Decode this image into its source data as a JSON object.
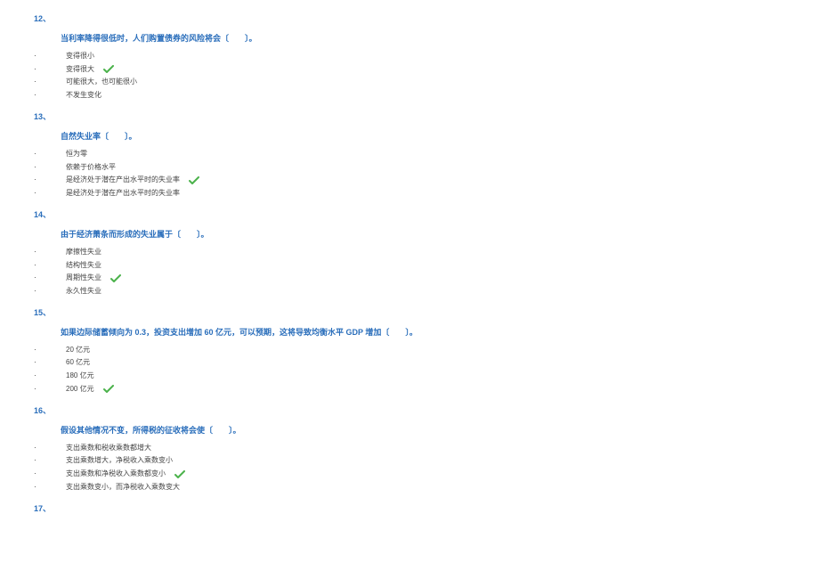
{
  "questions": [
    {
      "num": "12、",
      "stem": "当利率降得很低时，人们购置债券的风险将会〔　　〕。",
      "options": [
        {
          "text": "变得很小",
          "correct": false
        },
        {
          "text": "变得很大",
          "correct": true
        },
        {
          "text": "可能很大，也可能很小",
          "correct": false
        },
        {
          "text": "不发生变化",
          "correct": false
        }
      ]
    },
    {
      "num": "13、",
      "stem": "自然失业率〔　　〕。",
      "options": [
        {
          "text": "恒为零",
          "correct": false
        },
        {
          "text": "依赖于价格水平",
          "correct": false
        },
        {
          "text": "是经济处于潜在产出水平时的失业率",
          "correct": true
        },
        {
          "text": "是经济处于潜在产出水平时的失业率",
          "correct": false
        }
      ]
    },
    {
      "num": "14、",
      "stem": "由于经济萧条而形成的失业属于〔　　〕。",
      "options": [
        {
          "text": "摩擦性失业",
          "correct": false
        },
        {
          "text": "结构性失业",
          "correct": false
        },
        {
          "text": "周期性失业",
          "correct": true
        },
        {
          "text": "永久性失业",
          "correct": false
        }
      ]
    },
    {
      "num": "15、",
      "stem": "如果边际储蓄倾向为 0.3，投资支出增加 60 亿元，可以预期，这将导致均衡水平 GDP 增加〔　　〕。",
      "options": [
        {
          "text": "20 亿元",
          "correct": false
        },
        {
          "text": "60 亿元",
          "correct": false
        },
        {
          "text": "180 亿元",
          "correct": false
        },
        {
          "text": "200 亿元",
          "correct": true
        }
      ]
    },
    {
      "num": "16、",
      "stem": "假设其他情况不变，所得税的征收将会使〔　　〕。",
      "options": [
        {
          "text": "支出乘数和税收乘数都增大",
          "correct": false
        },
        {
          "text": "支出乘数增大，净税收入乘数变小",
          "correct": false
        },
        {
          "text": "支出乘数和净税收入乘数都变小",
          "correct": true
        },
        {
          "text": "支出乘数变小，而净税收入乘数变大",
          "correct": false
        }
      ]
    },
    {
      "num": "17、",
      "stem": "",
      "options": []
    }
  ]
}
